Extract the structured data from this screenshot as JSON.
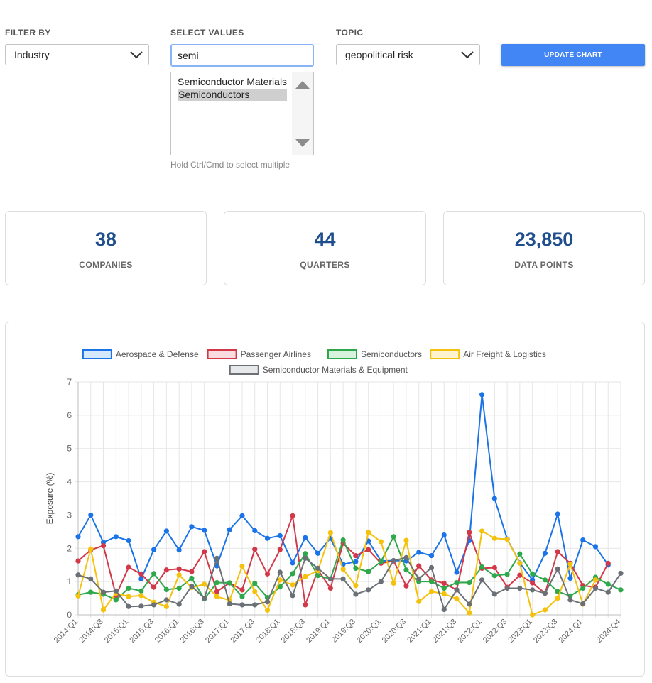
{
  "filters": {
    "filter_by": {
      "label": "FILTER BY",
      "value": "Industry"
    },
    "select_values": {
      "label": "SELECT VALUES",
      "search_value": "semi",
      "options": [
        "Semiconductor Materials",
        "Semiconductors"
      ],
      "selected": "Semiconductors",
      "hint": "Hold Ctrl/Cmd to select multiple"
    },
    "topic": {
      "label": "TOPIC",
      "value": "geopolitical risk"
    },
    "update_button": "UPDATE CHART"
  },
  "stats": [
    {
      "value": "38",
      "label": "COMPANIES"
    },
    {
      "value": "44",
      "label": "QUARTERS"
    },
    {
      "value": "23,850",
      "label": "DATA POINTS"
    }
  ],
  "chart_data": {
    "type": "line",
    "title": "",
    "xlabel": "",
    "ylabel": "Exposure (%)",
    "ylim": [
      0,
      7
    ],
    "yticks": [
      0,
      1,
      2,
      3,
      4,
      5,
      6,
      7
    ],
    "grid": true,
    "legend_position": "top",
    "x": [
      "2014:Q1",
      "2014:Q2",
      "2014:Q3",
      "2014:Q4",
      "2015:Q1",
      "2015:Q2",
      "2015:Q3",
      "2015:Q4",
      "2016:Q1",
      "2016:Q2",
      "2016:Q3",
      "2016:Q4",
      "2017:Q1",
      "2017:Q2",
      "2017:Q3",
      "2017:Q4",
      "2018:Q1",
      "2018:Q2",
      "2018:Q3",
      "2018:Q4",
      "2019:Q1",
      "2019:Q2",
      "2019:Q3",
      "2019:Q4",
      "2020:Q1",
      "2020:Q2",
      "2020:Q3",
      "2020:Q4",
      "2021:Q1",
      "2021:Q2",
      "2021:Q3",
      "2021:Q4",
      "2022:Q1",
      "2022:Q2",
      "2022:Q3",
      "2022:Q4",
      "2023:Q1",
      "2023:Q2",
      "2023:Q3",
      "2023:Q4",
      "2024:Q1",
      "2024:Q2",
      "2024:Q3",
      "2024:Q4"
    ],
    "x_tick_labels": [
      "2014:Q1",
      "2014:Q3",
      "2015:Q1",
      "2015:Q3",
      "2016:Q1",
      "2016:Q3",
      "2017:Q1",
      "2017:Q3",
      "2018:Q1",
      "2018:Q3",
      "2019:Q1",
      "2019:Q3",
      "2020:Q1",
      "2020:Q3",
      "2021:Q1",
      "2021:Q3",
      "2022:Q1",
      "2022:Q3",
      "2023:Q1",
      "2023:Q3",
      "2024:Q1",
      "2024:Q4"
    ],
    "series": [
      {
        "name": "Aerospace & Defense",
        "color": "#1a73e8",
        "fill": "#d6e8fb",
        "values": [
          2.35,
          3.0,
          2.18,
          2.35,
          2.23,
          1.08,
          1.96,
          2.52,
          1.95,
          2.65,
          2.54,
          1.47,
          2.56,
          2.98,
          2.53,
          2.3,
          2.38,
          1.56,
          2.32,
          1.85,
          2.3,
          1.52,
          1.6,
          2.22,
          1.62,
          1.63,
          1.62,
          1.88,
          1.78,
          2.4,
          1.28,
          2.23,
          6.62,
          3.5,
          2.28,
          1.56,
          1.05,
          1.85,
          3.03,
          1.1,
          2.25,
          2.05,
          1.5,
          null
        ]
      },
      {
        "name": "Passenger Airlines",
        "color": "#d23848",
        "fill": "#fadde1",
        "values": [
          1.62,
          1.95,
          2.08,
          0.58,
          1.43,
          1.23,
          0.83,
          1.35,
          1.38,
          1.3,
          1.9,
          0.7,
          0.96,
          0.75,
          1.97,
          1.23,
          1.96,
          2.98,
          0.3,
          1.35,
          0.8,
          2.15,
          1.78,
          1.96,
          1.55,
          1.62,
          0.87,
          1.47,
          1.05,
          0.95,
          0.75,
          2.48,
          1.4,
          1.42,
          0.83,
          1.19,
          0.96,
          0.65,
          1.9,
          1.55,
          0.88,
          0.83,
          1.55,
          null
        ]
      },
      {
        "name": "Semiconductors",
        "color": "#2ea84a",
        "fill": "#d9f2de",
        "values": [
          0.6,
          0.68,
          0.62,
          0.45,
          0.8,
          0.72,
          1.24,
          0.76,
          0.8,
          1.1,
          0.48,
          0.97,
          0.96,
          0.55,
          0.95,
          0.52,
          0.84,
          1.24,
          1.84,
          1.18,
          1.08,
          2.25,
          1.4,
          1.3,
          1.6,
          2.35,
          1.35,
          1.0,
          1.0,
          0.8,
          0.97,
          0.97,
          1.44,
          1.18,
          1.22,
          1.83,
          1.23,
          1.05,
          0.7,
          0.57,
          0.8,
          1.13,
          0.92,
          0.75
        ]
      },
      {
        "name": "Air Freight & Logistics",
        "color": "#f4c20d",
        "fill": "#fdf3cf",
        "values": [
          0.57,
          1.98,
          0.15,
          0.65,
          0.55,
          0.58,
          0.38,
          0.25,
          1.2,
          0.82,
          0.92,
          0.55,
          0.44,
          1.46,
          0.7,
          0.14,
          1.05,
          0.9,
          1.15,
          1.33,
          2.47,
          1.37,
          0.88,
          2.48,
          2.2,
          0.95,
          2.24,
          0.4,
          0.7,
          0.63,
          0.48,
          0.06,
          2.52,
          2.3,
          2.27,
          1.55,
          0.0,
          0.15,
          0.5,
          1.53,
          0.32,
          1.05,
          null,
          null
        ]
      },
      {
        "name": "Semiconductor Materials & Equipment",
        "color": "#6b7076",
        "fill": "#e6e8ea",
        "values": [
          1.2,
          1.08,
          0.68,
          0.72,
          0.25,
          0.26,
          0.3,
          0.45,
          0.32,
          0.86,
          0.5,
          1.7,
          0.33,
          0.3,
          0.3,
          0.39,
          1.28,
          0.58,
          1.7,
          1.4,
          1.08,
          1.08,
          0.62,
          0.75,
          1.0,
          1.63,
          1.72,
          1.08,
          1.42,
          0.16,
          0.75,
          0.32,
          1.05,
          0.62,
          0.8,
          0.8,
          0.75,
          0.65,
          1.38,
          0.45,
          0.33,
          0.8,
          0.68,
          1.25
        ]
      }
    ]
  }
}
